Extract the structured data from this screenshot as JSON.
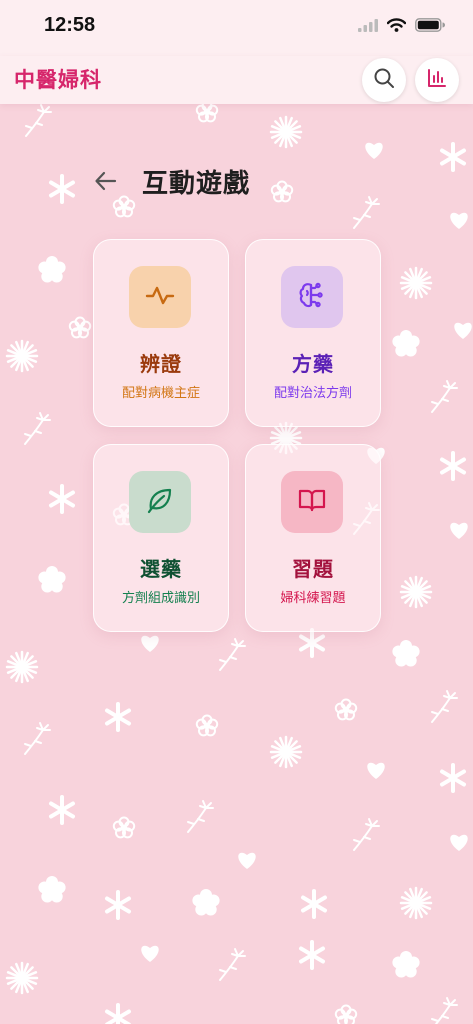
{
  "status_bar": {
    "time": "12:58"
  },
  "header": {
    "app_title": "中醫婦科",
    "search_icon": "search-icon",
    "stats_icon": "bar-chart-icon"
  },
  "page": {
    "title": "互動遊戲",
    "back_icon": "arrow-left-icon"
  },
  "games": [
    {
      "title": "辨證",
      "subtitle": "配對病機主症",
      "icon": "pulse-icon",
      "color": "#c76a12",
      "bg": "#f8d2ac"
    },
    {
      "title": "方藥",
      "subtitle": "配對治法方劑",
      "icon": "brain-icon",
      "color": "#7c3aed",
      "bg": "#e0c6ee"
    },
    {
      "title": "選藥",
      "subtitle": "方劑組成識別",
      "icon": "leaf-icon",
      "color": "#14804f",
      "bg": "#c9dccd"
    },
    {
      "title": "習題",
      "subtitle": "婦科練習題",
      "icon": "book-open-icon",
      "color": "#d4164e",
      "bg": "#f6b7c5"
    }
  ],
  "colors": {
    "background": "#f8d3dc",
    "brand": "#d6266b"
  }
}
